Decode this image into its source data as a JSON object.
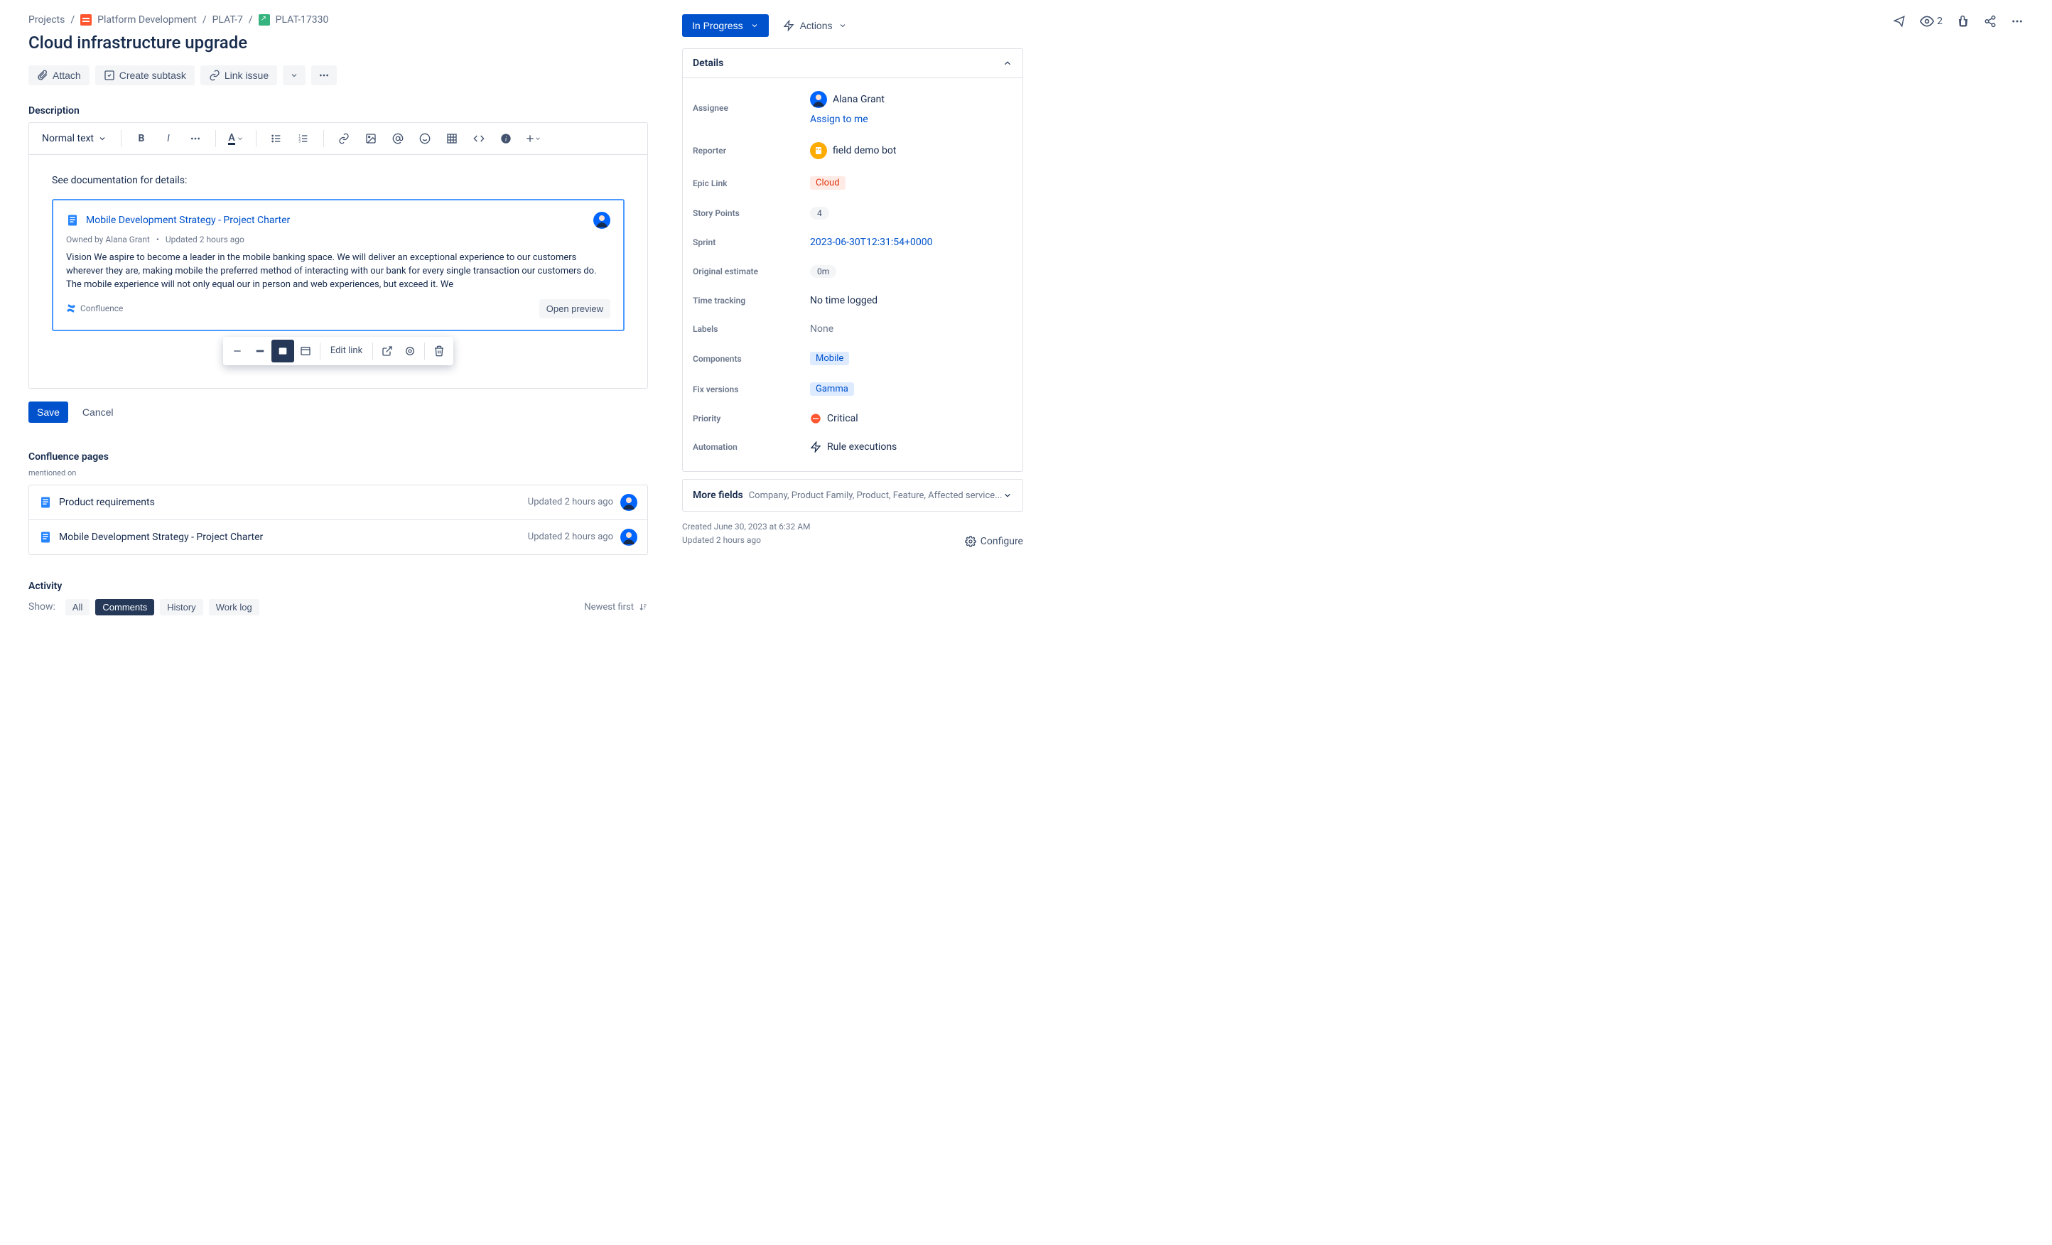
{
  "breadcrumb": {
    "projects": "Projects",
    "project": "Platform Development",
    "epic": "PLAT-7",
    "issue": "PLAT-17330"
  },
  "title": "Cloud infrastructure upgrade",
  "header_actions": {
    "watch_count": "2"
  },
  "actions": {
    "attach": "Attach",
    "create_subtask": "Create subtask",
    "link_issue": "Link issue"
  },
  "description": {
    "label": "Description",
    "text_style": "Normal text",
    "intro": "See documentation for details:",
    "card": {
      "title": "Mobile Development Strategy - Project Charter",
      "owned_by_prefix": "Owned by ",
      "owner": "Alana Grant",
      "updated": "Updated 2 hours ago",
      "excerpt": "Vision We aspire to become a leader in the mobile banking space. We will deliver an exceptional experience to our customers wherever they are, making mobile the preferred method of interacting with our bank for every single transaction our customers do. The mobile experience will not only equal our in person and web experiences, but exceed it. We",
      "source": "Confluence",
      "open_preview": "Open preview"
    },
    "floating": {
      "edit_link": "Edit link"
    },
    "save": "Save",
    "cancel": "Cancel"
  },
  "confluence_pages": {
    "label": "Confluence pages",
    "hint": "mentioned on",
    "rows": [
      {
        "title": "Product requirements",
        "updated": "Updated 2 hours ago"
      },
      {
        "title": "Mobile Development Strategy - Project Charter",
        "updated": "Updated 2 hours ago"
      }
    ]
  },
  "activity": {
    "label": "Activity",
    "show": "Show:",
    "tabs": {
      "all": "All",
      "comments": "Comments",
      "history": "History",
      "worklog": "Work log"
    },
    "newest": "Newest first"
  },
  "status": {
    "label": "In Progress",
    "actions_label": "Actions"
  },
  "details": {
    "heading": "Details",
    "assignee": {
      "label": "Assignee",
      "name": "Alana Grant",
      "assign_me": "Assign to me"
    },
    "reporter": {
      "label": "Reporter",
      "name": "field demo bot"
    },
    "epic_link": {
      "label": "Epic Link",
      "value": "Cloud"
    },
    "story_points": {
      "label": "Story Points",
      "value": "4"
    },
    "sprint": {
      "label": "Sprint",
      "value": "2023-06-30T12:31:54+0000"
    },
    "original_estimate": {
      "label": "Original estimate",
      "value": "0m"
    },
    "time_tracking": {
      "label": "Time tracking",
      "value": "No time logged"
    },
    "labels": {
      "label": "Labels",
      "value": "None"
    },
    "components": {
      "label": "Components",
      "value": "Mobile"
    },
    "fix_versions": {
      "label": "Fix versions",
      "value": "Gamma"
    },
    "priority": {
      "label": "Priority",
      "value": "Critical"
    },
    "automation": {
      "label": "Automation",
      "value": "Rule executions"
    }
  },
  "more_fields": {
    "label": "More fields",
    "sub": "Company, Product Family, Product, Feature, Affected service..."
  },
  "timestamps": {
    "created": "Created June 30, 2023 at 6:32 AM",
    "updated": "Updated 2 hours ago",
    "configure": "Configure"
  }
}
